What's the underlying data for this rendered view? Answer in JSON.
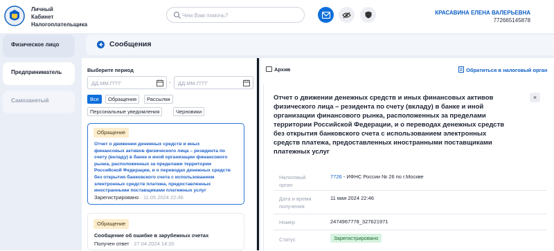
{
  "header": {
    "brand_line1": "Личный",
    "brand_line2": "Кабинет",
    "brand_line3": "Налогоплательщика",
    "search_placeholder": "Чем Вам помочь?",
    "user_name": "КРАСАВИНА ЕЛЕНА ВАЛЕРЬЕВНА",
    "user_inn": "772665145878"
  },
  "sidebar": {
    "items": [
      {
        "label": "Физическое лицо",
        "state": "active"
      },
      {
        "label": "Предприниматель",
        "state": "normal"
      },
      {
        "label": "Самозанятый",
        "state": "disabled"
      }
    ]
  },
  "page": {
    "title": "Сообщения"
  },
  "filter": {
    "period_label": "Выберите период",
    "date_from_placeholder": "ДД.ММ.ГГГГ",
    "date_to_placeholder": "ДД.ММ.ГГГГ",
    "chips": [
      {
        "label": "Все",
        "active": true
      },
      {
        "label": "Обращения",
        "active": false
      },
      {
        "label": "Рассылки",
        "active": false
      },
      {
        "label": "Персональные уведомления",
        "active": false
      },
      {
        "label": "Черновики",
        "active": false
      }
    ]
  },
  "messages": [
    {
      "badge": "Обращение",
      "title_lines": [
        "Отчет о движении денежных средств и иных",
        "финансовых активов физического лица – резидента по",
        "счету (вкладу) в банке и иной организации финансового",
        "рынка, расположенных за пределами территории",
        "Российской Федерации, и о переводах денежных средств",
        "без открытия банковского счета с использованием",
        "электронных средств платежа, предоставленных",
        "иностранными поставщиками платежных услуг"
      ],
      "status": "Зарегистрировано",
      "separator": "·",
      "date": "11.05.2024 22:46"
    },
    {
      "badge": "Обращение",
      "title": "Сообщение об ошибке в зарубежных счетах",
      "status": "Получен ответ",
      "separator": "·",
      "date": "27.04.2024 14:20"
    }
  ],
  "detail": {
    "archive_label": "Архив",
    "contact_label": "Обратиться в налоговый орган",
    "close_symbol": "×",
    "title_lines": [
      "Отчет о движении денежных средств и иных финансовых активов",
      "физического лица – резидента по счету (вкладу) в банке и иной",
      "организации финансового рынка, расположенных за пределами",
      "территории Российской Федерации, и о переводах денежных средств",
      "без открытия банковского счета с использованием электронных",
      "средств платежа, предоставленных иностранными поставщиками",
      "платежных услуг"
    ],
    "fields": {
      "tax_office_label_1": "Налоговый",
      "tax_office_label_2": "орган",
      "tax_office_code": "7726",
      "tax_office_name": "- ИФНС России № 26 по г.Москве",
      "datetime_label_1": "Дата и время",
      "datetime_label_2": "получения",
      "datetime_value": "11 мая 2024 22:46",
      "number_label": "Номер",
      "number_value": "2474967778_327621971",
      "status_label": "Статус",
      "status_value": "Зарегистрировано"
    }
  },
  "colors": {
    "accent": "#0d6edb",
    "link": "#0d5fc5",
    "badge_bg": "#fdeccb",
    "status_green_bg": "#d7f3df"
  }
}
